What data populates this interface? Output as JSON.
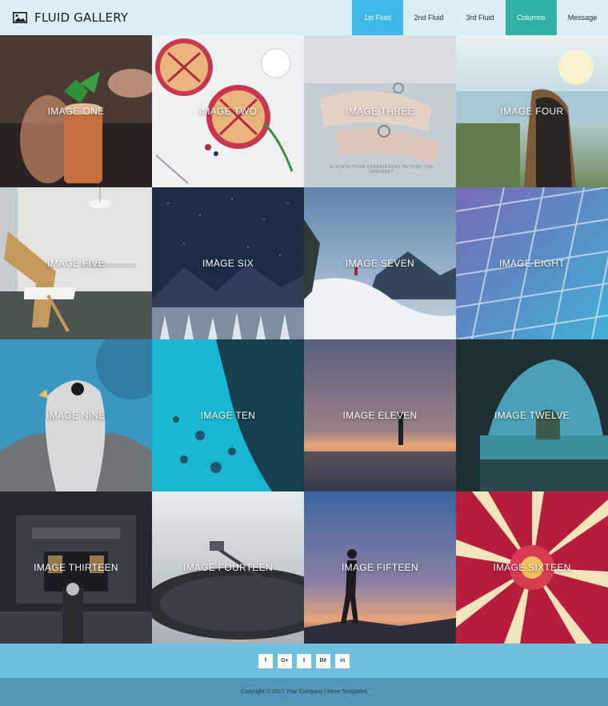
{
  "header": {
    "brand_icon": "image-icon",
    "title": "FLUID GALLERY",
    "nav": [
      {
        "label": "1st Fluid",
        "bg": "#3db8e8",
        "fg": "#ffffff"
      },
      {
        "label": "2nd Fluid",
        "bg": "",
        "fg": "#2a2a2a"
      },
      {
        "label": "3rd Fluid",
        "bg": "",
        "fg": "#2a2a2a"
      },
      {
        "label": "Columns",
        "bg": "#2fb0a3",
        "fg": "#ffffff"
      },
      {
        "label": "Message",
        "bg": "",
        "fg": "#2a2a2a"
      }
    ]
  },
  "gallery": {
    "tiles": [
      {
        "caption": "IMAGE ONE",
        "scene": "cocktail-with-mint",
        "colors": [
          "#4c3b33",
          "#1d1a18"
        ]
      },
      {
        "caption": "IMAGE TWO",
        "scene": "berry-pies-on-table",
        "colors": [
          "#eef0f1",
          "#cfd4d6"
        ]
      },
      {
        "caption": "IMAGE THREE",
        "scene": "hands-with-rings",
        "colors": [
          "#c8ced6",
          "#9aa3b0"
        ]
      },
      {
        "caption": "IMAGE FOUR",
        "scene": "woman-at-sunset-lake",
        "colors": [
          "#bcd7e0",
          "#6f8a63"
        ]
      },
      {
        "caption": "IMAGE FIVE",
        "scene": "wooden-chair-interior",
        "colors": [
          "#e3e3e0",
          "#595c5a"
        ]
      },
      {
        "caption": "IMAGE SIX",
        "scene": "starry-night-snowy-forest",
        "colors": [
          "#1d2d48",
          "#43557a"
        ]
      },
      {
        "caption": "IMAGE SEVEN",
        "scene": "snowy-mountain-hiker",
        "colors": [
          "#6b8fb3",
          "#e9eef2"
        ]
      },
      {
        "caption": "IMAGE EIGHT",
        "scene": "geometric-glass-ceiling",
        "colors": [
          "#6a6fb8",
          "#49a1c6"
        ]
      },
      {
        "caption": "IMAGE NINE",
        "scene": "falcon-portrait",
        "colors": [
          "#3f9cc7",
          "#2c6f8f"
        ]
      },
      {
        "caption": "IMAGE TEN",
        "scene": "aerial-turquoise-sea",
        "colors": [
          "#1ab4cf",
          "#16404e"
        ]
      },
      {
        "caption": "IMAGE ELEVEN",
        "scene": "beach-at-dusk",
        "colors": [
          "#545a7a",
          "#2c3044"
        ]
      },
      {
        "caption": "IMAGE TWELVE",
        "scene": "sea-cave-arch",
        "colors": [
          "#1f3336",
          "#3d7f86"
        ]
      },
      {
        "caption": "IMAGE THIRTEEN",
        "scene": "theater-tuschinski-street",
        "colors": [
          "#23262b",
          "#484e55"
        ]
      },
      {
        "caption": "IMAGE FOURTEEN",
        "scene": "turntable-record-player",
        "colors": [
          "#dde3e6",
          "#343a3f"
        ]
      },
      {
        "caption": "IMAGE FIFTEEN",
        "scene": "silhouette-at-dusk",
        "colors": [
          "#3d6aa2",
          "#e8a77c"
        ]
      },
      {
        "caption": "IMAGE SIXTEEN",
        "scene": "red-flower-closeup",
        "colors": [
          "#f2e2b7",
          "#c2203f"
        ]
      }
    ],
    "fineprint_three": "ELEVATE YOUR EXPERIENCES BEYOND THE ORDINARY"
  },
  "footer": {
    "social": [
      {
        "label": "f",
        "icon": "facebook-icon"
      },
      {
        "label": "G+",
        "icon": "google-plus-icon"
      },
      {
        "label": "t",
        "icon": "twitter-icon"
      },
      {
        "label": "Bē",
        "icon": "behance-icon"
      },
      {
        "label": "in",
        "icon": "linkedin-icon"
      }
    ],
    "copyright": "Copyright © 2017 Your Company",
    "separator": "|",
    "more_link": "More Templates"
  }
}
